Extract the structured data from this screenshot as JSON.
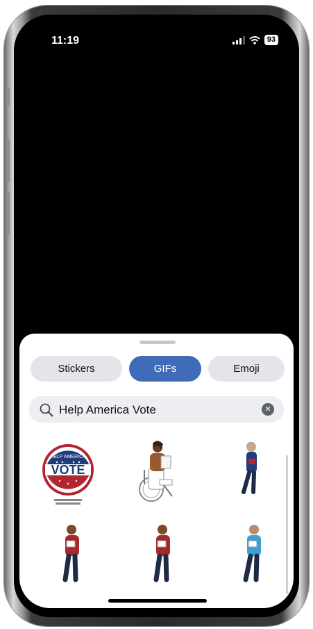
{
  "status_bar": {
    "time": "11:19",
    "battery": "93"
  },
  "segments": [
    {
      "label": "Stickers",
      "active": false
    },
    {
      "label": "GIFs",
      "active": true
    },
    {
      "label": "Emoji",
      "active": false
    }
  ],
  "search": {
    "value": "Help America Vote"
  },
  "gifs": [
    {
      "name": "Help America Vote button",
      "text_top": "HELP AMERICA",
      "text_main": "VOTE"
    },
    {
      "name": "Person in wheelchair holding ballot"
    },
    {
      "name": "Person holding ballot"
    },
    {
      "name": "Person holding ballot"
    },
    {
      "name": "Person holding ballot"
    },
    {
      "name": "Person holding ballot"
    }
  ],
  "colors": {
    "accent": "#3f6bb8",
    "seal_red": "#b32630",
    "seal_blue": "#1f3d7a"
  }
}
